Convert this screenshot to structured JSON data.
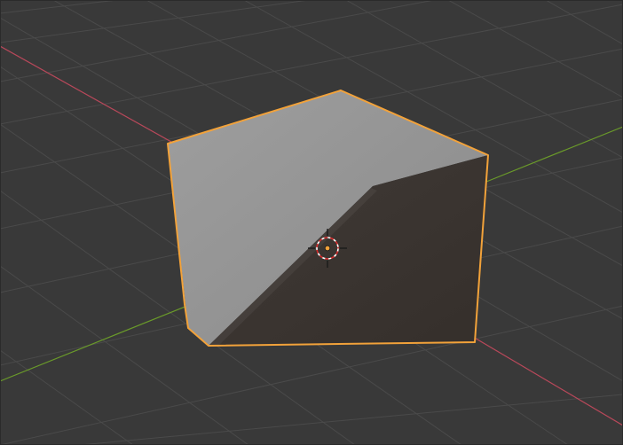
{
  "app": {
    "window_type": "3d-viewport"
  },
  "viewport": {
    "background_color": "#393939",
    "grid_color": "#4a4a4a",
    "axis_x_color": "#b8485a",
    "axis_y_color": "#6a9a2a",
    "selection_outline_color": "#f2a23a"
  },
  "object": {
    "selected": true,
    "top_face_color": "#8d8d8d",
    "left_face_color": "#9b9b9b",
    "dark_face_color": "#3a3532"
  },
  "cursor_3d": {
    "icon": "3d-cursor-icon"
  },
  "origin": {
    "icon": "object-origin-icon",
    "color": "#f2a23a"
  }
}
